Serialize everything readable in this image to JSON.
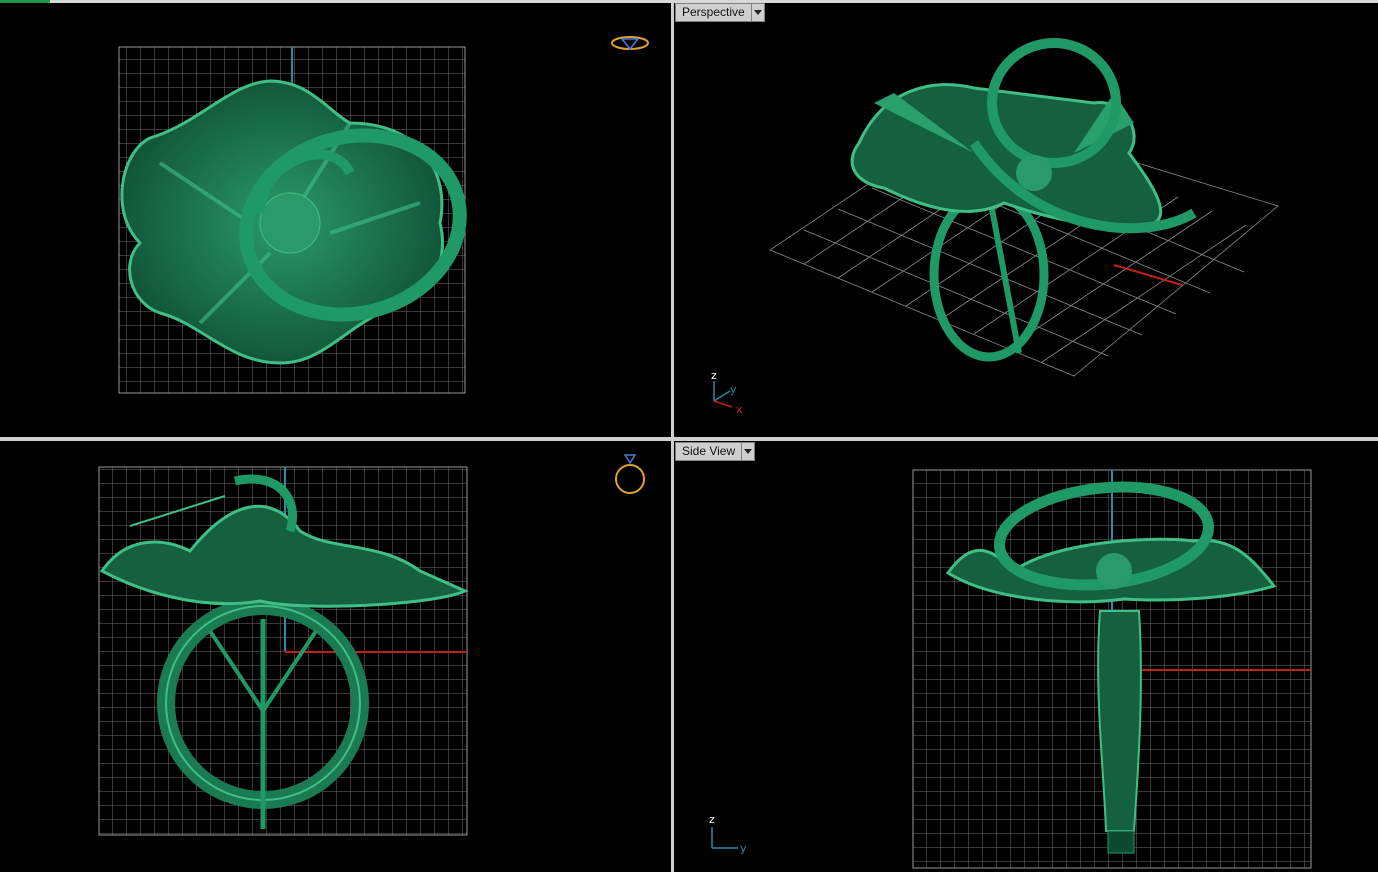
{
  "viewports": {
    "top_left": {
      "label": "",
      "view_icon": "ring-top-view-icon"
    },
    "top_right": {
      "label": "Perspective",
      "axes": {
        "z": "z",
        "y": "y",
        "x": "x"
      }
    },
    "bottom_left": {
      "label": "",
      "view_icon": "ring-front-view-icon"
    },
    "bottom_right": {
      "label": "Side View",
      "axes": {
        "z": "z",
        "y": "y"
      }
    }
  },
  "colors": {
    "model": "#1a7a52",
    "model_light": "#3fbf85",
    "grid": "#8a8a8a",
    "axis_x": "#c0201a",
    "axis_z": "#2a8aa8",
    "icon": "#e0a030"
  }
}
